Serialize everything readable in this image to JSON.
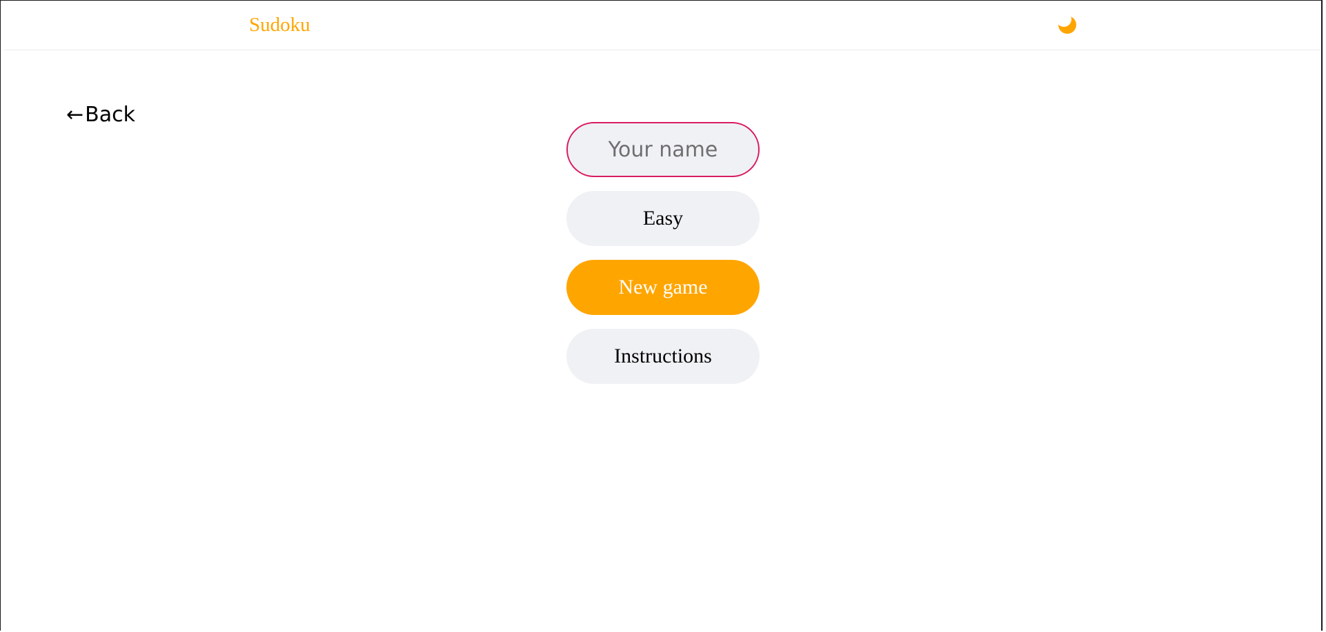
{
  "header": {
    "brand": "Sudoku",
    "theme_icon": "moon-icon"
  },
  "colors": {
    "accent": "#ffa500",
    "input_border": "#d81b60",
    "pill_background": "#f0f1f5"
  },
  "nav": {
    "back_arrow": "←",
    "back_label": "Back"
  },
  "menu": {
    "name_placeholder": "Your name",
    "name_value": "",
    "difficulty_label": "Easy",
    "new_game_label": "New game",
    "instructions_label": "Instructions"
  }
}
